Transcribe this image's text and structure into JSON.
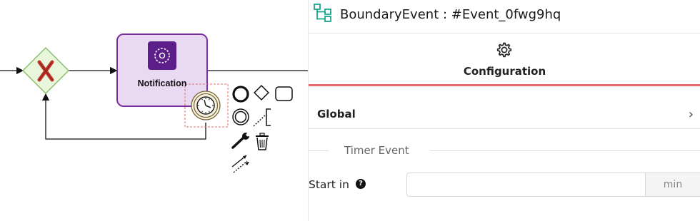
{
  "canvas": {
    "task": {
      "label": "Notification"
    },
    "gateway": {
      "type": "exclusive"
    },
    "palette": {
      "items": [
        "end-event",
        "gateway",
        "task",
        "intermediate-event",
        "text-annotation",
        "wrench",
        "delete",
        "connect"
      ]
    }
  },
  "panel": {
    "header": {
      "title": "BoundaryEvent : #Event_0fwg9hq",
      "icon": "bpmn-element-icon"
    },
    "tab": {
      "label": "Configuration",
      "icon": "gear-icon"
    },
    "section": {
      "label": "Global",
      "chevron": "›"
    },
    "group": {
      "label": "Timer Event"
    },
    "field": {
      "label": "Start in",
      "help": "?",
      "value": "",
      "unit": "min"
    }
  },
  "colors": {
    "task_fill": "#e9d9f3",
    "task_border": "#7a2ea0",
    "task_icon_bg": "#5c1f8a",
    "gateway_fill": "#e8f6dc",
    "gateway_x": "#c0392b",
    "accent": "#e36b6b",
    "header_icon": "#1aa58f"
  }
}
